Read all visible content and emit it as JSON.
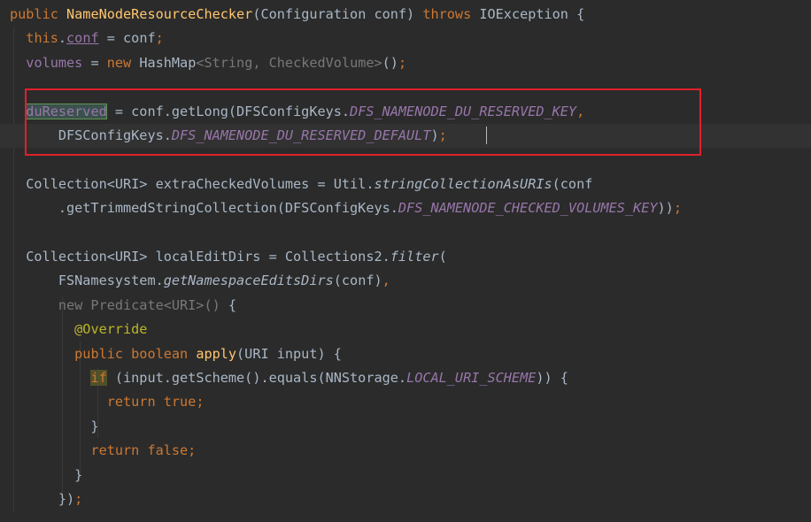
{
  "editor": {
    "lines": [
      {
        "tokens": [
          {
            "t": "public ",
            "c": "kw"
          },
          {
            "t": "NameNodeResourceChecker",
            "c": "fn"
          },
          {
            "t": "(Configuration conf) ",
            "c": "plain"
          },
          {
            "t": "throws ",
            "c": "kw"
          },
          {
            "t": "IOException {",
            "c": "plain"
          }
        ]
      },
      {
        "tokens": [
          {
            "t": "  ",
            "c": "plain"
          },
          {
            "t": "this",
            "c": "kw"
          },
          {
            "t": ".",
            "c": "plain"
          },
          {
            "t": "conf",
            "c": "link"
          },
          {
            "t": " = conf",
            "c": "plain"
          },
          {
            "t": ";",
            "c": "kw"
          }
        ]
      },
      {
        "tokens": [
          {
            "t": "  ",
            "c": "plain"
          },
          {
            "t": "volumes",
            "c": "field"
          },
          {
            "t": " = ",
            "c": "plain"
          },
          {
            "t": "new ",
            "c": "kw"
          },
          {
            "t": "HashMap",
            "c": "plain"
          },
          {
            "t": "<String, CheckedVolume>",
            "c": "grey"
          },
          {
            "t": "()",
            "c": "plain"
          },
          {
            "t": ";",
            "c": "kw"
          }
        ]
      },
      {
        "tokens": []
      },
      {
        "tokens": [
          {
            "t": "  ",
            "c": "plain"
          },
          {
            "t": "duReserved",
            "c": "field hl-var"
          },
          {
            "t": " = conf.getLong(DFSConfigKeys.",
            "c": "plain"
          },
          {
            "t": "DFS_NAMENODE_DU_RESERVED_KEY",
            "c": "sfield"
          },
          {
            "t": ",",
            "c": "kw"
          }
        ]
      },
      {
        "tokens": [
          {
            "t": "      DFSConfigKeys.",
            "c": "plain"
          },
          {
            "t": "DFS_NAMENODE_DU_RESERVED_DEFAULT",
            "c": "sfield"
          },
          {
            "t": ")",
            "c": "plain"
          },
          {
            "t": ";",
            "c": "kw"
          }
        ],
        "caret": true
      },
      {
        "tokens": []
      },
      {
        "tokens": [
          {
            "t": "  Collection<URI> extraCheckedVolumes = Util.",
            "c": "plain"
          },
          {
            "t": "stringCollectionAsURIs",
            "c": "smeth"
          },
          {
            "t": "(conf",
            "c": "plain"
          }
        ]
      },
      {
        "tokens": [
          {
            "t": "      .getTrimmedStringCollection(DFSConfigKeys.",
            "c": "plain"
          },
          {
            "t": "DFS_NAMENODE_CHECKED_VOLUMES_KEY",
            "c": "sfield"
          },
          {
            "t": "))",
            "c": "plain"
          },
          {
            "t": ";",
            "c": "kw"
          }
        ]
      },
      {
        "tokens": []
      },
      {
        "tokens": [
          {
            "t": "  Collection<URI> localEditDirs = Collections2.",
            "c": "plain"
          },
          {
            "t": "filter",
            "c": "smeth"
          },
          {
            "t": "(",
            "c": "plain"
          }
        ]
      },
      {
        "tokens": [
          {
            "t": "      FSNamesystem.",
            "c": "plain"
          },
          {
            "t": "getNamespaceEditsDirs",
            "c": "smeth"
          },
          {
            "t": "(conf)",
            "c": "plain"
          },
          {
            "t": ",",
            "c": "kw"
          }
        ]
      },
      {
        "tokens": [
          {
            "t": "      new Predicate<URI>() ",
            "c": "grey"
          },
          {
            "t": "{",
            "c": "plain"
          }
        ]
      },
      {
        "tokens": [
          {
            "t": "        ",
            "c": "plain"
          },
          {
            "t": "@Override",
            "c": "ann"
          }
        ]
      },
      {
        "tokens": [
          {
            "t": "        ",
            "c": "plain"
          },
          {
            "t": "public boolean ",
            "c": "kw"
          },
          {
            "t": "apply",
            "c": "fn"
          },
          {
            "t": "(URI input) {",
            "c": "plain"
          }
        ]
      },
      {
        "tokens": [
          {
            "t": "          ",
            "c": "plain"
          },
          {
            "t": "if",
            "c": "kw hl-if"
          },
          {
            "t": " (input.getScheme().equals(NNStorage.",
            "c": "plain"
          },
          {
            "t": "LOCAL_URI_SCHEME",
            "c": "sfield"
          },
          {
            "t": ")) {",
            "c": "plain"
          }
        ]
      },
      {
        "tokens": [
          {
            "t": "            ",
            "c": "plain"
          },
          {
            "t": "return true;",
            "c": "kw"
          }
        ]
      },
      {
        "tokens": [
          {
            "t": "          }",
            "c": "plain"
          }
        ]
      },
      {
        "tokens": [
          {
            "t": "          ",
            "c": "plain"
          },
          {
            "t": "return false;",
            "c": "kw"
          }
        ]
      },
      {
        "tokens": [
          {
            "t": "        }",
            "c": "plain"
          }
        ]
      },
      {
        "tokens": [
          {
            "t": "      })",
            "c": "plain"
          },
          {
            "t": ";",
            "c": "kw"
          }
        ]
      }
    ]
  },
  "colors": {
    "background": "#2b2b2b",
    "keyword": "#cc7832",
    "method_decl": "#ffc66d",
    "field": "#9876aa",
    "annotation": "#bbb529",
    "highlight_box": "#e0202a"
  }
}
